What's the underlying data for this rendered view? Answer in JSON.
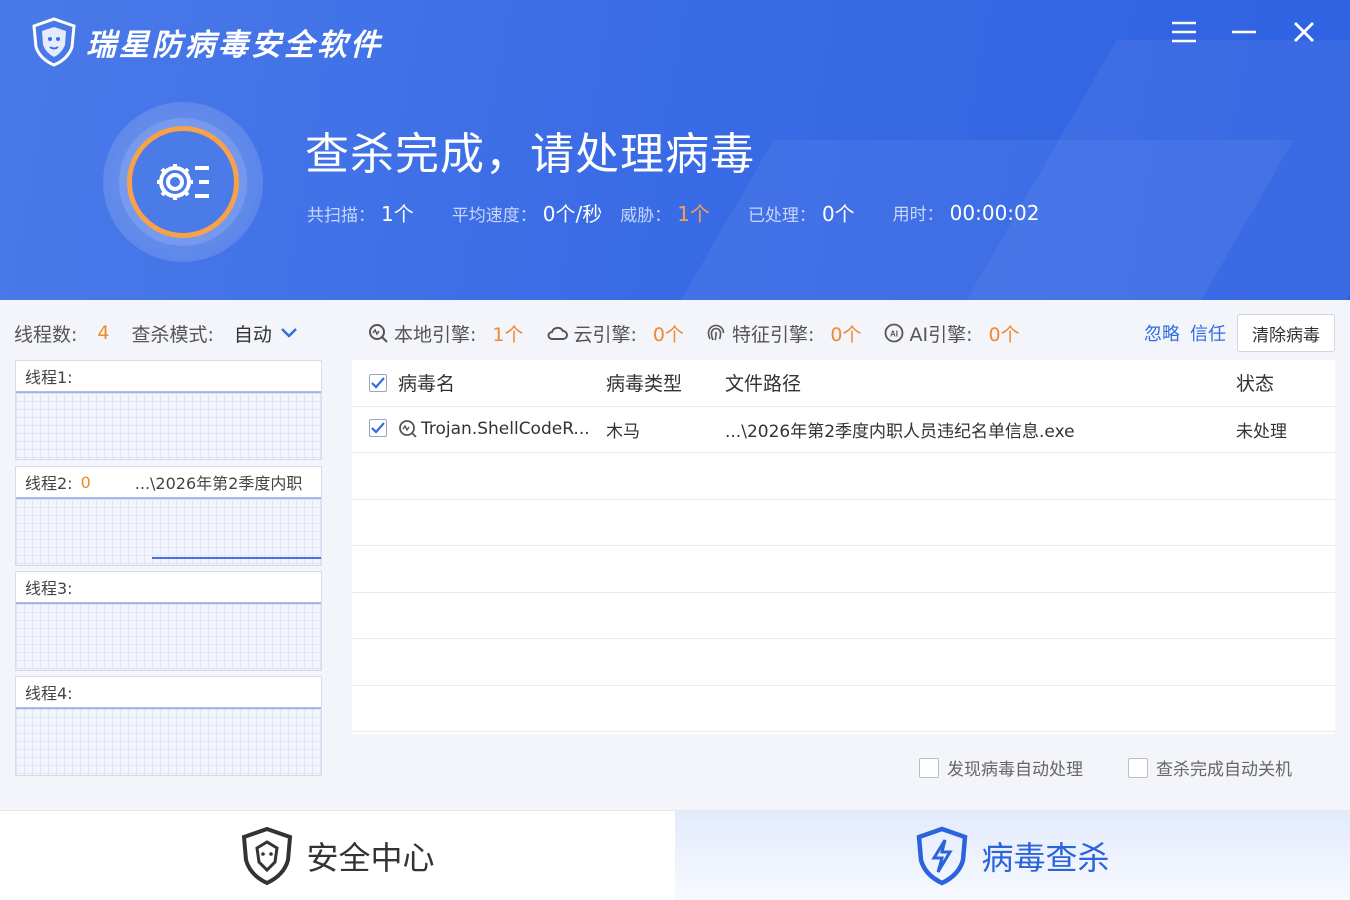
{
  "app": {
    "title": "瑞星防病毒安全软件"
  },
  "window_controls": {
    "menu_icon": "menu-icon",
    "minimize_icon": "minimize-icon",
    "close_icon": "close-icon"
  },
  "scan": {
    "headline": "查杀完成，请处理病毒",
    "stats": [
      {
        "label": "共扫描：",
        "value": "1个",
        "highlight": false
      },
      {
        "label": "平均速度：",
        "value": "0个/秒",
        "highlight": false
      },
      {
        "label": "威胁：",
        "value": "1个",
        "highlight": true
      },
      {
        "label": "已处理：",
        "value": "0个",
        "highlight": false
      },
      {
        "label": "用时：",
        "value": "00:00:02",
        "highlight": false
      }
    ]
  },
  "left": {
    "threads_label": "线程数:",
    "threads_value": "4",
    "mode_label": "查杀模式:",
    "mode_value": "自动",
    "threads": [
      {
        "label": "线程1:",
        "count": "",
        "path": ""
      },
      {
        "label": "线程2:",
        "count": "0",
        "path": "...\\2026年第2季度内职"
      },
      {
        "label": "线程3:",
        "count": "",
        "path": ""
      },
      {
        "label": "线程4:",
        "count": "",
        "path": ""
      }
    ]
  },
  "engines": [
    {
      "name": "本地引擎:",
      "count": "1个",
      "icon": "local-engine-icon"
    },
    {
      "name": "云引擎:",
      "count": "0个",
      "icon": "cloud-icon"
    },
    {
      "name": "特征引擎:",
      "count": "0个",
      "icon": "fingerprint-icon"
    },
    {
      "name": "AI引擎:",
      "count": "0个",
      "icon": "ai-icon"
    }
  ],
  "actions": {
    "ignore": "忽略",
    "trust": "信任",
    "clear": "清除病毒"
  },
  "table": {
    "columns": [
      "病毒名",
      "病毒类型",
      "文件路径",
      "状态"
    ],
    "rows": [
      {
        "checked": true,
        "name": "Trojan.ShellCodeR...",
        "type": "木马",
        "path": "...\\2026年第2季度内职人员违纪名单信息.exe",
        "status": "未处理"
      }
    ]
  },
  "options": {
    "auto_handle": "发现病毒自动处理",
    "auto_shutdown": "查杀完成自动关机"
  },
  "footer": {
    "tab1": "安全中心",
    "tab2": "病毒查杀",
    "active": "tab2"
  },
  "colors": {
    "header_blue": "#3b6ce6",
    "accent_orange": "#f0882d",
    "link_blue": "#2f6de0"
  }
}
